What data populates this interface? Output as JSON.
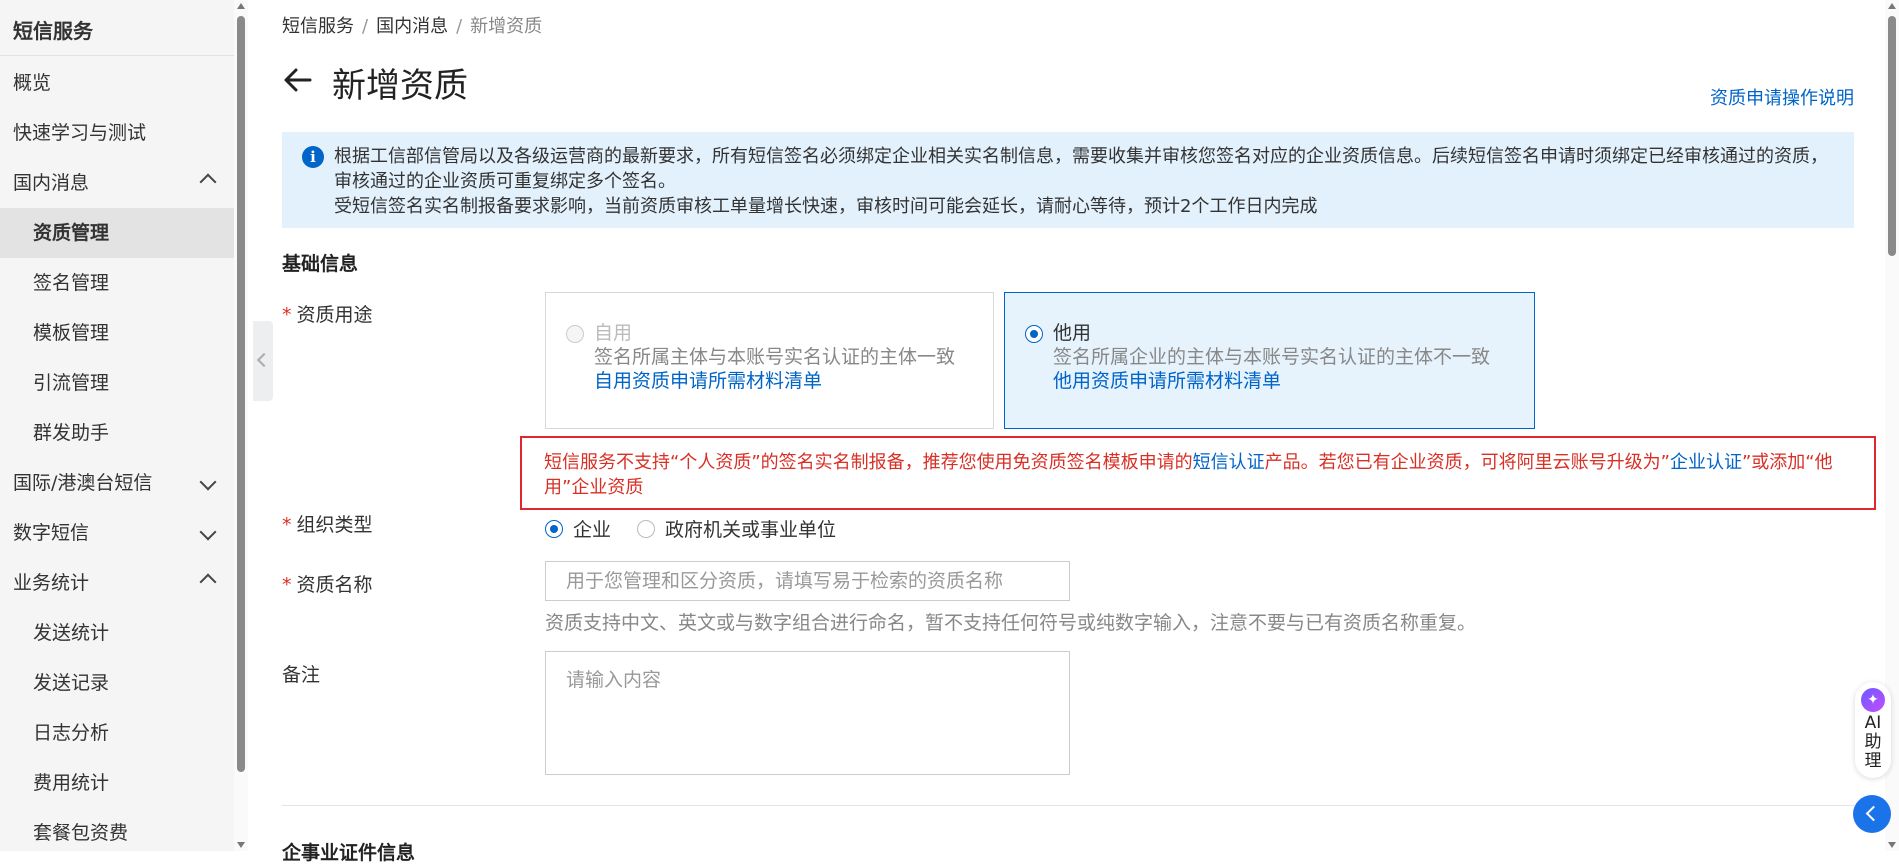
{
  "sidebar": {
    "title": "短信服务",
    "items": [
      {
        "label": "概览"
      },
      {
        "label": "快速学习与测试"
      },
      {
        "label": "国内消息"
      },
      {
        "label": "资质管理"
      },
      {
        "label": "签名管理"
      },
      {
        "label": "模板管理"
      },
      {
        "label": "引流管理"
      },
      {
        "label": "群发助手"
      },
      {
        "label": "国际/港澳台短信"
      },
      {
        "label": "数字短信"
      },
      {
        "label": "业务统计"
      },
      {
        "label": "发送统计"
      },
      {
        "label": "发送记录"
      },
      {
        "label": "日志分析"
      },
      {
        "label": "费用统计"
      },
      {
        "label": "套餐包资费"
      }
    ]
  },
  "breadcrumb": {
    "items": [
      "短信服务",
      "国内消息",
      "新增资质"
    ],
    "sep": "/"
  },
  "header": {
    "title": "新增资质",
    "help_link": "资质申请操作说明"
  },
  "notice": {
    "line1": "根据工信部信管局以及各级运营商的最新要求，所有短信签名必须绑定企业相关实名制信息，需要收集并审核您签名对应的企业资质信息。后续短信签名申请时须绑定已经审核通过的资质，审核通过的企业资质可重复绑定多个签名。",
    "line2": "受短信签名实名制报备要求影响，当前资质审核工单量增长快速，审核时间可能会延长，请耐心等待，预计2个工作日内完成"
  },
  "form": {
    "section_title": "基础信息",
    "usage": {
      "label": "资质用途",
      "options": [
        {
          "title": "自用",
          "desc": "签名所属主体与本账号实名认证的主体一致",
          "link": "自用资质申请所需材料清单"
        },
        {
          "title": "他用",
          "desc": "签名所属企业的主体与本账号实名认证的主体不一致",
          "link": "他用资质申请所需材料清单"
        }
      ]
    },
    "warning": {
      "p1": "短信服务不支持“个人资质”的签名实名制报备，推荐您使用免资质签名模板申请的",
      "link1": "短信认证",
      "p2": "产品。若您已有企业资质，可将阿里云账号升级为”",
      "link2": "企业认证",
      "p3": "”或添加“他用”企业资质"
    },
    "org_type": {
      "label": "组织类型",
      "options": [
        "企业",
        "政府机关或事业单位"
      ]
    },
    "name": {
      "label": "资质名称",
      "placeholder": "用于您管理和区分资质，请填写易于检索的资质名称",
      "hint": "资质支持中文、英文或与数字组合进行命名，暂不支持任何符号或纯数字输入，注意不要与已有资质名称重复。"
    },
    "remark": {
      "label": "备注",
      "placeholder": "请输入内容"
    },
    "next_section_title": "企事业证件信息"
  },
  "ai_assistant": {
    "label": "AI助理"
  },
  "colors": {
    "accent": "#0064c8",
    "warning": "#d93026",
    "notice_bg": "#e2f1fc"
  }
}
